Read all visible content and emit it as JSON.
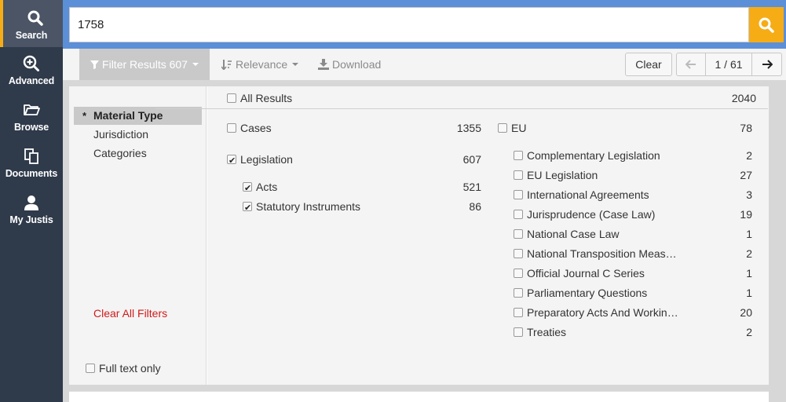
{
  "nav": [
    {
      "label": "Search",
      "icon": "search-icon"
    },
    {
      "label": "Advanced",
      "icon": "zoom-plus-icon"
    },
    {
      "label": "Browse",
      "icon": "folder-icon"
    },
    {
      "label": "Documents",
      "icon": "documents-icon"
    },
    {
      "label": "My Justis",
      "icon": "user-icon"
    }
  ],
  "search": {
    "value": "1758"
  },
  "toolbar": {
    "filter_label": "Filter Results 607",
    "relevance_label": "Relevance",
    "download_label": "Download",
    "clear_label": "Clear",
    "page_indicator": "1 / 61"
  },
  "categories": [
    {
      "label": "Material Type",
      "active": true,
      "marker": "*"
    },
    {
      "label": "Jurisdiction"
    },
    {
      "label": "Categories"
    }
  ],
  "clear_all_filters": "Clear All Filters",
  "full_text_only": "Full text only",
  "all_results": {
    "label": "All Results",
    "count": "2040"
  },
  "left_column": [
    {
      "label": "Cases",
      "count": "1355",
      "checked": false
    },
    {
      "label": "Legislation",
      "count": "607",
      "checked": true
    },
    {
      "label": "Acts",
      "count": "521",
      "checked": true
    },
    {
      "label": "Statutory Instruments",
      "count": "86",
      "checked": true
    }
  ],
  "eu": {
    "label": "EU",
    "count": "78"
  },
  "eu_items": [
    {
      "label": "Complementary Legislation",
      "count": "2"
    },
    {
      "label": "EU Legislation",
      "count": "27"
    },
    {
      "label": "International Agreements",
      "count": "3"
    },
    {
      "label": "Jurisprudence (Case Law)",
      "count": "19"
    },
    {
      "label": "National Case Law",
      "count": "1"
    },
    {
      "label": "National Transposition Meas…",
      "count": "2"
    },
    {
      "label": "Official Journal C Series",
      "count": "1"
    },
    {
      "label": "Parliamentary Questions",
      "count": "1"
    },
    {
      "label": "Preparatory Acts And Workin…",
      "count": "20"
    },
    {
      "label": "Treaties",
      "count": "2"
    }
  ],
  "colors": {
    "sidebar": "#2f3a4a",
    "accent": "#f6ac15",
    "header": "#5b8fd8",
    "danger": "#d11a1a"
  }
}
